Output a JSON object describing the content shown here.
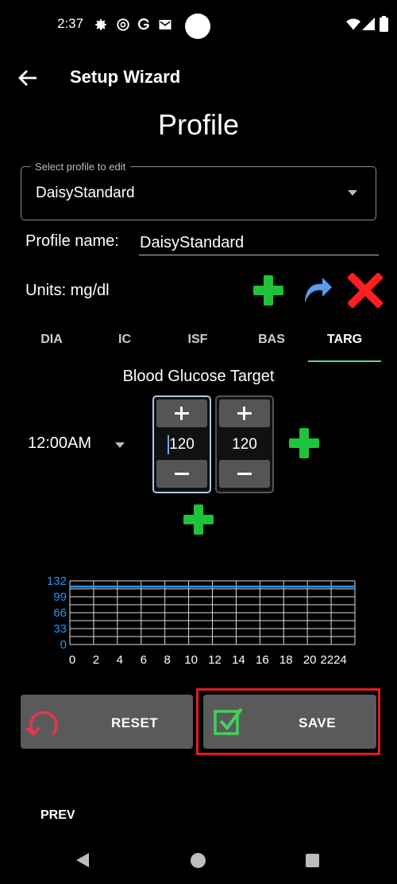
{
  "status_bar": {
    "time": "2:37"
  },
  "toolbar": {
    "title": "Setup Wizard"
  },
  "page": {
    "heading": "Profile"
  },
  "profile_select": {
    "label": "Select profile to edit",
    "value": "DaisyStandard"
  },
  "profile_name": {
    "label": "Profile name:",
    "value": "DaisyStandard"
  },
  "units": {
    "label": "Units: mg/dl"
  },
  "tabs": [
    {
      "label": "DIA"
    },
    {
      "label": "IC"
    },
    {
      "label": "ISF"
    },
    {
      "label": "BAS"
    },
    {
      "label": "TARG",
      "active": true
    }
  ],
  "target": {
    "title": "Blood Glucose Target",
    "time": "12:00AM",
    "low": "120",
    "high": "120"
  },
  "chart_data": {
    "type": "line",
    "x_ticks": [
      "0",
      "2",
      "4",
      "6",
      "8",
      "10",
      "12",
      "14",
      "16",
      "18",
      "20",
      "2224"
    ],
    "y_ticks": [
      "0",
      "33",
      "66",
      "99",
      "132"
    ],
    "xlim": [
      0,
      24
    ],
    "ylim": [
      0,
      132
    ],
    "series": [
      {
        "x": [
          0,
          24
        ],
        "y": [
          120,
          120
        ],
        "color": "#2196f3"
      }
    ],
    "grid": true
  },
  "buttons": {
    "reset": "RESET",
    "save": "SAVE",
    "prev": "PREV"
  },
  "colors": {
    "accent_green": "#1fc23b",
    "accent_red": "#ff1f1f",
    "tab_indicator": "#4fd2c4",
    "chart_line": "#2196f3"
  }
}
